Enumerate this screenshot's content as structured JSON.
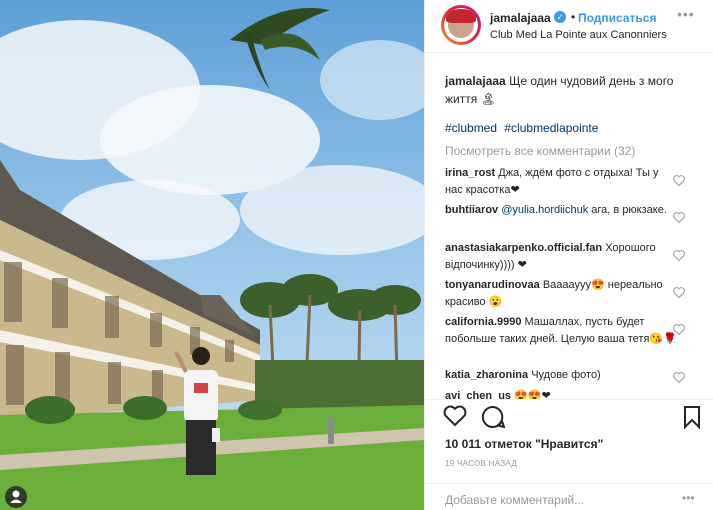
{
  "post": {
    "username": "jamalajaaa",
    "follow_label": "Подписаться",
    "dot": "•",
    "location": "Club Med La Pointe aux Canonniers",
    "more_label": "•••",
    "caption_user": "jamalajaaa",
    "caption_text": "Ще один чудовий день з мого життя 🏝",
    "hashtags": [
      "#clubmed",
      "#clubmedlapointe"
    ],
    "view_all_comments": "Посмотреть все комментарии (32)",
    "comments": [
      {
        "user": "irina_rost",
        "text": "Джа, ждём фото с отдыха! Ты у нас красотка❤"
      },
      {
        "user": "buhtiiarov",
        "mention": "@yulia.hordiichuk",
        "text": "ага, в рюкзаке."
      },
      {
        "user": "anastasiakarpenko.official.fan",
        "text": "Хорошого відпочинку)))) ❤"
      },
      {
        "user": "tonyanarudinovaa",
        "text": "Вааааууу😍 нереально красиво 😮"
      },
      {
        "user": "california.9990",
        "text": "Машаллах, пусть будет побольше таких дней. Целую ваша тетя😘🌹"
      },
      {
        "user": "katia_zharonina",
        "text": "Чудове фото)"
      },
      {
        "user": "avi_chen_us",
        "text": "😍😍❤"
      }
    ],
    "likes": "10 011 отметок \"Нравится\"",
    "time": "19 ЧАСОВ НАЗАД",
    "add_comment_placeholder": "Добавьте комментарий...",
    "comment_more": "•••"
  },
  "colors": {
    "link": "#3897f0",
    "hashtag": "#003569",
    "muted": "#999999",
    "text": "#262626"
  }
}
